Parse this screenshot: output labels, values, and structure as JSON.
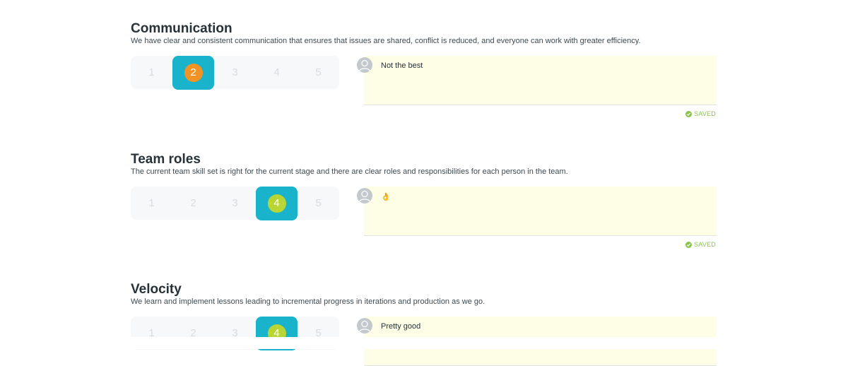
{
  "colors": {
    "selected_tile": "#1ab3cc",
    "score_2": "#f29425",
    "score_4": "#b7d533",
    "comment_bg": "#fefde6",
    "saved_green": "#8bc34a"
  },
  "sections": [
    {
      "title": "Communication",
      "description": "We have clear and consistent communication that ensures that issues are shared, conflict is reduced, and everyone can work with greater efficiency.",
      "options": [
        "1",
        "2",
        "3",
        "4",
        "5"
      ],
      "selected": "2",
      "comment": "Not the best",
      "status": "SAVED"
    },
    {
      "title": "Team roles",
      "description": "The current team skill set is right for the current stage and there are clear roles and responsibilities for each person in the team.",
      "options": [
        "1",
        "2",
        "3",
        "4",
        "5"
      ],
      "selected": "4",
      "comment": "👌",
      "status": "SAVED"
    },
    {
      "title": "Velocity",
      "description": "We learn and implement lessons leading to incremental progress in iterations and production as we go.",
      "options": [
        "1",
        "2",
        "3",
        "4",
        "5"
      ],
      "selected": "4",
      "comment": "Pretty good",
      "status": ""
    }
  ]
}
